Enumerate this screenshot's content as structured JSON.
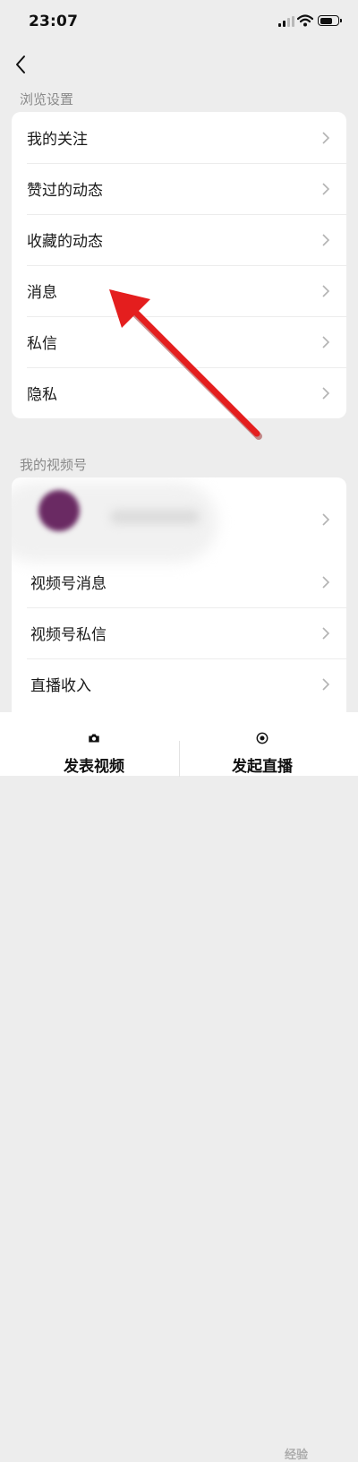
{
  "status_bar": {
    "time": "23:07",
    "battery_level": 0.75
  },
  "browse_section": {
    "label": "浏览设置",
    "items": [
      {
        "label": "我的关注"
      },
      {
        "label": "赞过的动态"
      },
      {
        "label": "收藏的动态"
      },
      {
        "label": "消息"
      },
      {
        "label": "私信"
      },
      {
        "label": "隐私"
      }
    ]
  },
  "channels_section": {
    "label": "我的视频号",
    "items": [
      {
        "label": "视频号消息"
      },
      {
        "label": "视频号私信"
      },
      {
        "label": "直播收入"
      }
    ]
  },
  "tabbar": {
    "publish_video": "发表视频",
    "start_live": "发起直播"
  },
  "watermark": {
    "text": "经验"
  },
  "colors": {
    "annotation_arrow": "#e41e1e",
    "background": "#ededed",
    "card": "#ffffff"
  }
}
